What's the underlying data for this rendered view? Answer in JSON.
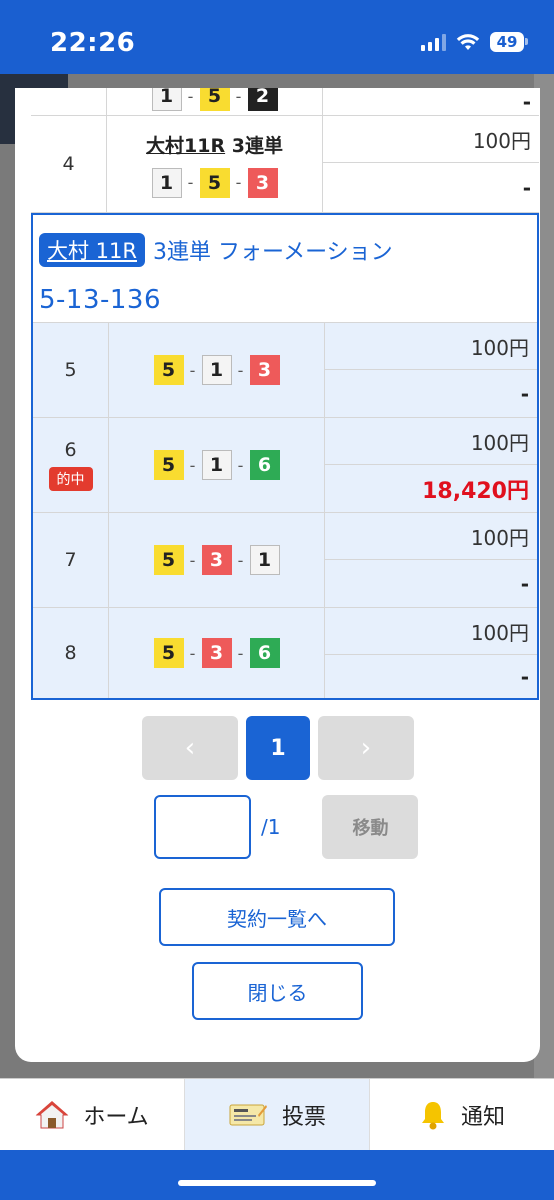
{
  "status": {
    "time": "22:26",
    "battery": "49"
  },
  "rows_top": [
    {
      "no": "",
      "combo": [
        "1",
        "5",
        "2"
      ],
      "race": "",
      "amount": "",
      "payout": "-"
    },
    {
      "no": "4",
      "race_venue": "大村11R",
      "race_type": "3連単",
      "combo": [
        "1",
        "5",
        "3"
      ],
      "amount": "100円",
      "payout": "-"
    }
  ],
  "formation": {
    "tag": "大村 11R",
    "title": "3連単 フォーメーション",
    "sub": "5-13-136",
    "rows": [
      {
        "no": "5",
        "combo": [
          "5",
          "1",
          "3"
        ],
        "amount": "100円",
        "payout": "-",
        "hit": ""
      },
      {
        "no": "6",
        "combo": [
          "5",
          "1",
          "6"
        ],
        "amount": "100円",
        "payout": "18,420円",
        "hit": "的中"
      },
      {
        "no": "7",
        "combo": [
          "5",
          "3",
          "1"
        ],
        "amount": "100円",
        "payout": "-",
        "hit": ""
      },
      {
        "no": "8",
        "combo": [
          "5",
          "3",
          "6"
        ],
        "amount": "100円",
        "payout": "-",
        "hit": ""
      }
    ]
  },
  "pager": {
    "prev": "‹",
    "current": "1",
    "next": "›",
    "total": "/1",
    "move": "移動"
  },
  "buttons": {
    "list": "契約一覧へ",
    "close": "閉じる"
  },
  "tabs": {
    "home": "ホーム",
    "vote": "投票",
    "notice": "通知"
  },
  "colors": {
    "accent": "#1a64d4",
    "win": "#e0101e",
    "box1": "#f4f4f4",
    "box2": "#222222",
    "box3": "#ee5a5a",
    "box5": "#f9dc30",
    "box6": "#2eab55"
  }
}
